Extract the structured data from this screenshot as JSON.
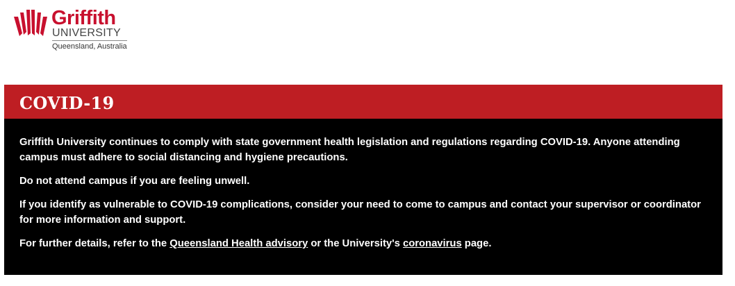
{
  "header": {
    "logo": {
      "wordmark": "Griffith",
      "subtitle": "UNIVERSITY",
      "location": "Queensland, Australia",
      "brand_color": "#c8102e"
    }
  },
  "notice": {
    "title": "COVID-19",
    "header_color": "#be1e23",
    "background_color": "#000000",
    "paragraphs": {
      "p1": "Griffith University continues to comply with state government health legislation and regulations regarding COVID-19. Anyone attending campus must adhere to social distancing and hygiene precautions.",
      "p2": "Do not attend campus if you are feeling unwell.",
      "p3": "If you identify as vulnerable to COVID-19 complications, consider your need to come to campus and contact your supervisor or coordinator for more information and support.",
      "p4_before": "For further details, refer to the ",
      "p4_link1": "Queensland Health advisory",
      "p4_middle": " or the University's ",
      "p4_link2": "coronavirus",
      "p4_after": " page."
    }
  }
}
